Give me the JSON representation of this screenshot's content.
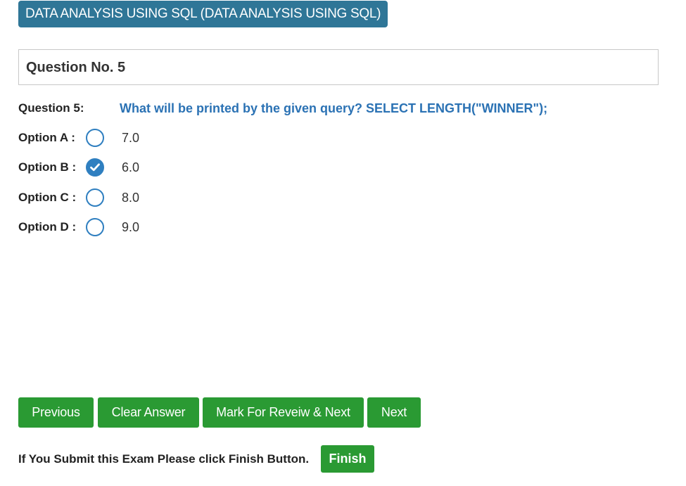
{
  "header": {
    "subject": "DATA ANALYSIS USING SQL (DATA ANALYSIS USING SQL)"
  },
  "question": {
    "number_title": "Question No. 5",
    "label": "Question 5:",
    "text": "What will be printed by the given query? SELECT LENGTH(\"WINNER\");"
  },
  "options": [
    {
      "label": "Option A :",
      "value": "7.0",
      "selected": false
    },
    {
      "label": "Option B :",
      "value": "6.0",
      "selected": true
    },
    {
      "label": "Option C :",
      "value": "8.0",
      "selected": false
    },
    {
      "label": "Option D :",
      "value": "9.0",
      "selected": false
    }
  ],
  "nav": {
    "previous_label": "Previous",
    "clear_label": "Clear Answer",
    "mark_review_label": "Mark For Reveiw & Next",
    "next_label": "Next"
  },
  "finish": {
    "note": "If You Submit this Exam Please click Finish Button.",
    "button_label": "Finish"
  },
  "colors": {
    "header_badge": "#2f7697",
    "question_text": "#2b72b4",
    "radio_accent": "#2f7fc0",
    "button_green": "#2a9a33"
  }
}
